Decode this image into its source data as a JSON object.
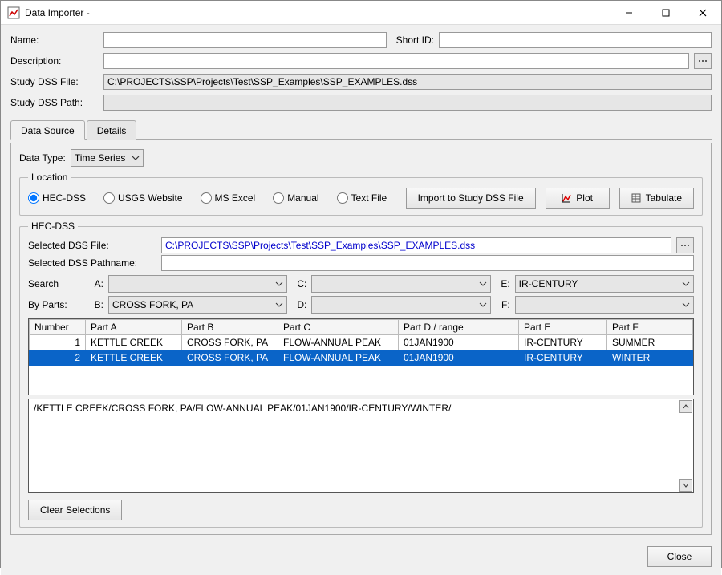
{
  "window": {
    "title": "Data Importer -"
  },
  "top_form": {
    "name_label": "Name:",
    "name_value": "",
    "short_id_label": "Short ID:",
    "short_id_value": "",
    "description_label": "Description:",
    "description_value": "",
    "study_dss_file_label": "Study DSS File:",
    "study_dss_file_value": "C:\\PROJECTS\\SSP\\Projects\\Test\\SSP_Examples\\SSP_EXAMPLES.dss",
    "study_dss_path_label": "Study DSS Path:",
    "study_dss_path_value": ""
  },
  "tabs": {
    "data_source": "Data Source",
    "details": "Details"
  },
  "data_type": {
    "label": "Data Type:",
    "value": "Time Series"
  },
  "location": {
    "legend": "Location",
    "options": {
      "hec_dss": "HEC-DSS",
      "usgs": "USGS Website",
      "excel": "MS Excel",
      "manual": "Manual",
      "textfile": "Text File"
    }
  },
  "actions": {
    "import": "Import to Study DSS File",
    "plot": "Plot",
    "tabulate": "Tabulate"
  },
  "hec_dss": {
    "legend": "HEC-DSS",
    "selected_file_label": "Selected DSS File:",
    "selected_file_value": "C:\\PROJECTS\\SSP\\Projects\\Test\\SSP_Examples\\SSP_EXAMPLES.dss",
    "selected_pathname_label": "Selected DSS Pathname:",
    "selected_pathname_value": "",
    "search_label": "Search",
    "byparts_label": "By Parts:",
    "parts": {
      "A": "",
      "B": "CROSS FORK, PA",
      "C": "",
      "D": "",
      "E": "IR-CENTURY",
      "F": ""
    },
    "part_labels": {
      "A": "A:",
      "B": "B:",
      "C": "C:",
      "D": "D:",
      "E": "E:",
      "F": "F:"
    },
    "columns": {
      "number": "Number",
      "a": "Part A",
      "b": "Part B",
      "c": "Part C",
      "d": "Part D / range",
      "e": "Part E",
      "f": "Part F"
    },
    "rows": [
      {
        "num": "1",
        "a": "KETTLE CREEK",
        "b": "CROSS FORK, PA",
        "c": "FLOW-ANNUAL PEAK",
        "d": "01JAN1900",
        "e": "IR-CENTURY",
        "f": "SUMMER",
        "selected": false
      },
      {
        "num": "2",
        "a": "KETTLE CREEK",
        "b": "CROSS FORK, PA",
        "c": "FLOW-ANNUAL PEAK",
        "d": "01JAN1900",
        "e": "IR-CENTURY",
        "f": "WINTER",
        "selected": true
      }
    ],
    "path_display": "/KETTLE CREEK/CROSS FORK, PA/FLOW-ANNUAL PEAK/01JAN1900/IR-CENTURY/WINTER/",
    "clear_selections": "Clear Selections"
  },
  "footer": {
    "close": "Close"
  }
}
